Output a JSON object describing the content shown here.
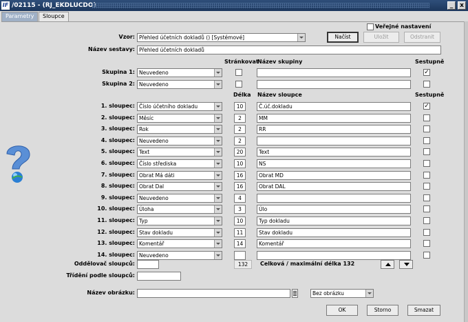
{
  "window": {
    "title": "/02115 - (RJ_EKDLUCDO)",
    "logo": "IF",
    "minimize_glyph": "_",
    "close_glyph": "x"
  },
  "tabs": [
    {
      "label": "Parametry",
      "active": false
    },
    {
      "label": "Sloupce",
      "active": true
    }
  ],
  "header": {
    "public_settings_label": "Veřejné nastavení",
    "public_settings_checked": false,
    "vzor_label": "Vzor:",
    "vzor_value": "Přehled účetních dokladů  ()  [Systémové]",
    "load_button": "Načíst",
    "save_button": "Uložit",
    "remove_button": "Odstranit",
    "report_name_label": "Název sestavy:",
    "report_name_value": "Přehled účetních dokladů"
  },
  "groups_header": {
    "paging": "Stránkovat",
    "group_name": "Název skupiny",
    "descending": "Sestupně"
  },
  "groups": [
    {
      "label": "Skupina 1:",
      "value": "Neuvedeno",
      "paging": false,
      "name": "",
      "descending": true
    },
    {
      "label": "Skupina 2:",
      "value": "Neuvedeno",
      "paging": false,
      "name": "",
      "descending": false
    }
  ],
  "columns_header": {
    "length": "Délka",
    "column_name": "Název sloupce",
    "descending": "Sestupně"
  },
  "columns": [
    {
      "label": "1. sloupec:",
      "value": "Číslo účetního dokladu",
      "length": "10",
      "name": "Č.úč.dokladu",
      "descending": true
    },
    {
      "label": "2. sloupec:",
      "value": "Měsíc",
      "length": "2",
      "name": "MM",
      "descending": false
    },
    {
      "label": "3. sloupec:",
      "value": "Rok",
      "length": "2",
      "name": "RR",
      "descending": false
    },
    {
      "label": "4. sloupec:",
      "value": "Neuvedeno",
      "length": "2",
      "name": "",
      "descending": false
    },
    {
      "label": "5. sloupec:",
      "value": "Text",
      "length": "20",
      "name": "Text",
      "descending": false
    },
    {
      "label": "6. sloupec:",
      "value": "Číslo střediska",
      "length": "10",
      "name": "NS",
      "descending": false
    },
    {
      "label": "7. sloupec:",
      "value": "Obrat Má dáti",
      "length": "16",
      "name": "Obrat MD",
      "descending": false
    },
    {
      "label": "8. sloupec:",
      "value": "Obrat Dal",
      "length": "16",
      "name": "Obrat DAL",
      "descending": false
    },
    {
      "label": "9. sloupec:",
      "value": "Neuvedeno",
      "length": "4",
      "name": "",
      "descending": false
    },
    {
      "label": "10. sloupec:",
      "value": "Úloha",
      "length": "3",
      "name": "Úlo",
      "descending": false
    },
    {
      "label": "11. sloupec:",
      "value": "Typ",
      "length": "10",
      "name": "Typ dokladu",
      "descending": false
    },
    {
      "label": "12. sloupec:",
      "value": "Stav dokladu",
      "length": "11",
      "name": "Stav dokladu",
      "descending": false
    },
    {
      "label": "13. sloupec:",
      "value": "Komentář",
      "length": "14",
      "name": "Komentář",
      "descending": false
    },
    {
      "label": "14. sloupec:",
      "value": "Neuvedeno",
      "length": "",
      "name": "",
      "descending": false
    }
  ],
  "footer": {
    "separator_label": "Oddělovač sloupců:",
    "separator_value": "",
    "total_length": "132",
    "total_length_label": "Celková / maximální délka 132",
    "sort_label": "Třídění podle sloupců:",
    "sort_value": "",
    "image_name_label": "Název obrázku:",
    "image_name_value": "",
    "image_option": "Bez obrázku",
    "ok_button": "OK",
    "cancel_button": "Storno",
    "delete_button": "Smazat"
  },
  "colors": {
    "titlebar": "#2f4f7a",
    "tab_inactive": "#9fb0c6",
    "background": "#dcdcdc",
    "help_icon": "#5a8fd6"
  },
  "icons": {
    "help": "question-mark-icon",
    "move_up": "arrow-up-icon",
    "move_down": "arrow-down-icon",
    "list": "list-icon"
  }
}
